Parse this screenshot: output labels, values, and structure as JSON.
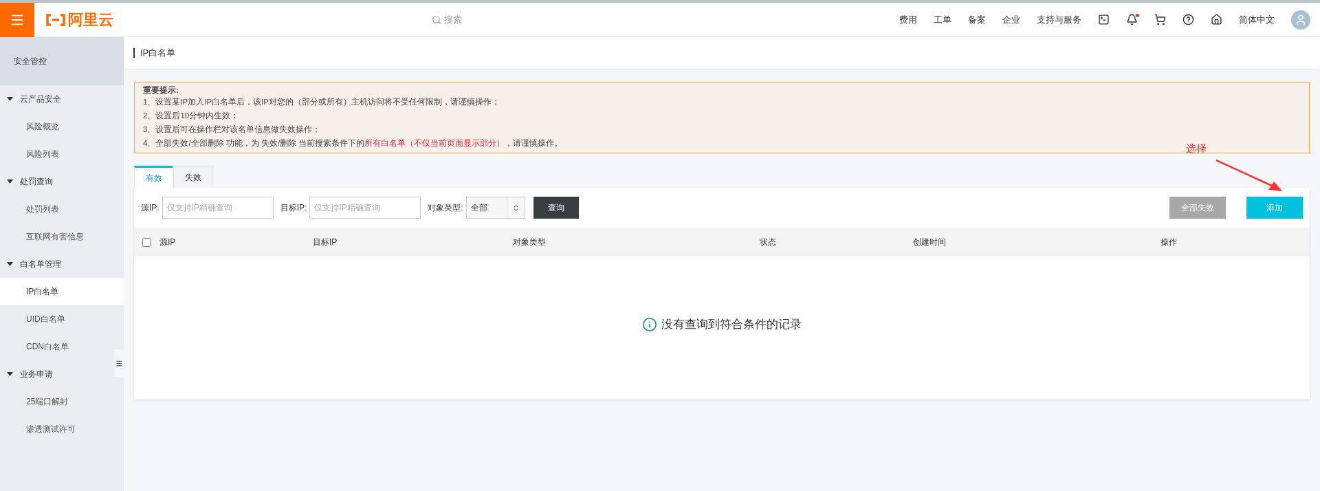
{
  "topbar": {
    "logo": "阿里云",
    "search": {
      "placeholder": "搜索"
    },
    "links": [
      "费用",
      "工单",
      "备案",
      "企业",
      "支持与服务"
    ],
    "notification_dot": true,
    "language": "简体中文"
  },
  "sidebar": {
    "title": "安全管控",
    "groups": [
      {
        "label": "云产品安全",
        "expanded": true,
        "children": [
          {
            "label": "风险概览",
            "selected": false
          },
          {
            "label": "风险列表",
            "selected": false
          }
        ]
      },
      {
        "label": "处罚查询",
        "expanded": true,
        "children": [
          {
            "label": "处罚列表",
            "selected": false
          },
          {
            "label": "互联网有害信息",
            "selected": false
          }
        ]
      },
      {
        "label": "白名单管理",
        "expanded": true,
        "children": [
          {
            "label": "IP白名单",
            "selected": true
          },
          {
            "label": "UID白名单",
            "selected": false
          },
          {
            "label": "CDN白名单",
            "selected": false
          }
        ]
      },
      {
        "label": "业务申请",
        "expanded": true,
        "children": [
          {
            "label": "25端口解封",
            "selected": false
          },
          {
            "label": "渗透测试许可",
            "selected": false
          }
        ]
      }
    ]
  },
  "page_title": "IP白名单",
  "notice": {
    "title": "重要提示:",
    "lines": [
      [
        {
          "text": "1、设置某IP加入IP白名单后，该IP对您的（部分或所有）主机访问将不受任何限制，请谨慎操作；",
          "highlight": false
        }
      ],
      [
        {
          "text": "2、设置后10分钟内生效；",
          "highlight": false
        }
      ],
      [
        {
          "text": "3、设置后可在操作栏对该名单信息做失效操作；",
          "highlight": false
        }
      ],
      [
        {
          "text": "4、全部失效/全部删除 功能，为 失效/删除 当前搜索条件下的",
          "highlight": false
        },
        {
          "text": "所有白名单（不仅当前页面显示部分）",
          "highlight": true
        },
        {
          "text": "，请谨慎操作。",
          "highlight": false
        }
      ]
    ]
  },
  "annotation": "选择",
  "tabs": [
    {
      "label": "有效",
      "selected": true
    },
    {
      "label": "失效",
      "selected": false
    }
  ],
  "filters": {
    "source_ip": {
      "label": "源IP:",
      "placeholder": "仅支持IP精确查询"
    },
    "target_ip": {
      "label": "目标IP:",
      "placeholder": "仅支持IP精确查询"
    },
    "object_type": {
      "label": "对象类型:",
      "value": "全部"
    },
    "query_button": "查询"
  },
  "actions": [
    {
      "label": "全部失效",
      "disabled": true
    },
    {
      "label": "添加",
      "disabled": false
    }
  ],
  "table": {
    "select_all": {
      "checked": false
    },
    "columns": [
      "源IP",
      "目标IP",
      "对象类型",
      "状态",
      "创建时间",
      "操作"
    ],
    "empty_message": "没有查询到符合条件的记录"
  }
}
